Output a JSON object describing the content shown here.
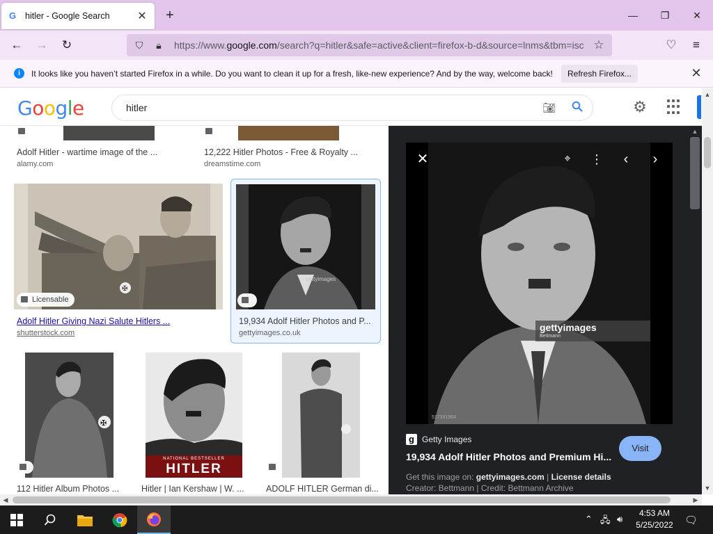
{
  "browser": {
    "tab_title": "hitler - Google Search",
    "url_prefix": "https://www.",
    "url_domain": "google.com",
    "url_rest": "/search?q=hitler&safe=active&client=firefox-b-d&source=lnms&tbm=isc",
    "notice_text": "It looks like you haven’t started Firefox in a while. Do you want to clean it up for a fresh, like-new experience? And by the way, welcome back!",
    "refresh_label": "Refresh Firefox..."
  },
  "google": {
    "logo": [
      "G",
      "o",
      "o",
      "g",
      "l",
      "e"
    ],
    "query": "hitler"
  },
  "results": [
    {
      "title": "Adolf Hitler - wartime image of the ...",
      "source": "alamy.com"
    },
    {
      "title": "12,222 Hitler Photos - Free & Royalty ...",
      "source": "dreamstime.com"
    },
    {
      "title": "Adolf Hitler Giving Nazi Salute Hitlers ...",
      "source": "shutterstock.com",
      "badge": "Licensable"
    },
    {
      "title": "19,934 Adolf Hitler Photos and P...",
      "source": "gettyimages.co.uk",
      "watermark": "gettyimages"
    },
    {
      "title": "112 Hitler Album Photos ...",
      "source": ""
    },
    {
      "title": "Hitler | Ian Kershaw | W. ...",
      "source": "",
      "cover_small": "NATIONAL BESTSELLER",
      "cover_big": "HITLER"
    },
    {
      "title": "ADOLF HITLER German di...",
      "source": ""
    }
  ],
  "preview": {
    "watermark": "gettyimages",
    "watermark_credit": "Bettmann",
    "image_id": "517391964",
    "source_name": "Getty Images",
    "title": "19,934 Adolf Hitler Photos and Premium Hi...",
    "visit_label": "Visit",
    "get_image_label": "Get this image on:",
    "get_image_site": "gettyimages.com",
    "separator": "|",
    "license_label": "License details",
    "credit_line": "Creator: Bettmann | Credit: Bettmann Archive"
  },
  "taskbar": {
    "time": "4:53 AM",
    "date": "5/25/2022"
  },
  "colors": {
    "tabbar": "#e3c5ec",
    "navbar": "#f3e4f7",
    "accent_blue": "#4285f4",
    "visit_button": "#8ab4f8",
    "preview_bg": "#202124"
  }
}
